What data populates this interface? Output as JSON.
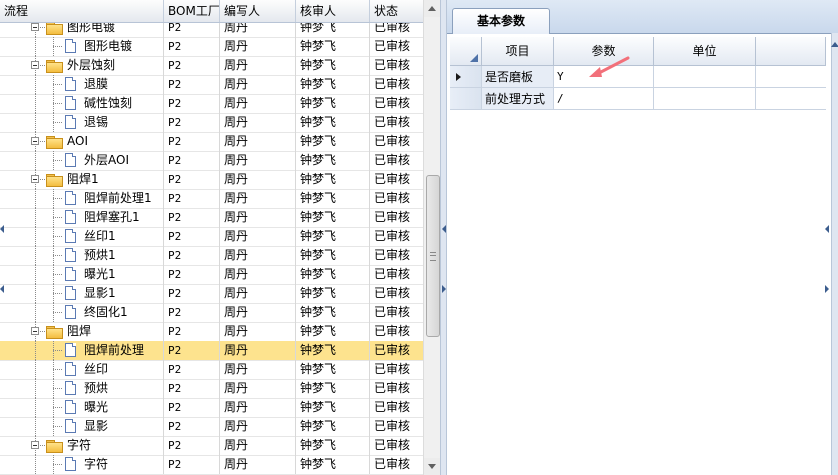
{
  "tree": {
    "columns": {
      "name": "流程",
      "bom": "BOM工厂",
      "writer": "编写人",
      "reviewer": "核审人",
      "status": "状态"
    },
    "rows": [
      {
        "name": "图形电镀",
        "type": "folder",
        "level": 0,
        "bom": "P2",
        "writer": "周丹",
        "reviewer": "钟梦飞",
        "status": "已审核"
      },
      {
        "name": "图形电镀",
        "type": "item",
        "level": 1,
        "bom": "P2",
        "writer": "周丹",
        "reviewer": "钟梦飞",
        "status": "已审核"
      },
      {
        "name": "外层蚀刻",
        "type": "folder",
        "level": 0,
        "bom": "P2",
        "writer": "周丹",
        "reviewer": "钟梦飞",
        "status": "已审核"
      },
      {
        "name": "退膜",
        "type": "item",
        "level": 1,
        "bom": "P2",
        "writer": "周丹",
        "reviewer": "钟梦飞",
        "status": "已审核"
      },
      {
        "name": "碱性蚀刻",
        "type": "item",
        "level": 1,
        "bom": "P2",
        "writer": "周丹",
        "reviewer": "钟梦飞",
        "status": "已审核"
      },
      {
        "name": "退锡",
        "type": "item",
        "level": 1,
        "bom": "P2",
        "writer": "周丹",
        "reviewer": "钟梦飞",
        "status": "已审核"
      },
      {
        "name": "AOI",
        "type": "folder",
        "level": 0,
        "bom": "P2",
        "writer": "周丹",
        "reviewer": "钟梦飞",
        "status": "已审核"
      },
      {
        "name": "外层AOI",
        "type": "item",
        "level": 1,
        "bom": "P2",
        "writer": "周丹",
        "reviewer": "钟梦飞",
        "status": "已审核"
      },
      {
        "name": "阻焊1",
        "type": "folder",
        "level": 0,
        "bom": "P2",
        "writer": "周丹",
        "reviewer": "钟梦飞",
        "status": "已审核"
      },
      {
        "name": "阻焊前处理1",
        "type": "item",
        "level": 1,
        "bom": "P2",
        "writer": "周丹",
        "reviewer": "钟梦飞",
        "status": "已审核"
      },
      {
        "name": "阻焊塞孔1",
        "type": "item",
        "level": 1,
        "bom": "P2",
        "writer": "周丹",
        "reviewer": "钟梦飞",
        "status": "已审核"
      },
      {
        "name": "丝印1",
        "type": "item",
        "level": 1,
        "bom": "P2",
        "writer": "周丹",
        "reviewer": "钟梦飞",
        "status": "已审核"
      },
      {
        "name": "预烘1",
        "type": "item",
        "level": 1,
        "bom": "P2",
        "writer": "周丹",
        "reviewer": "钟梦飞",
        "status": "已审核"
      },
      {
        "name": "曝光1",
        "type": "item",
        "level": 1,
        "bom": "P2",
        "writer": "周丹",
        "reviewer": "钟梦飞",
        "status": "已审核"
      },
      {
        "name": "显影1",
        "type": "item",
        "level": 1,
        "bom": "P2",
        "writer": "周丹",
        "reviewer": "钟梦飞",
        "status": "已审核"
      },
      {
        "name": "终固化1",
        "type": "item",
        "level": 1,
        "bom": "P2",
        "writer": "周丹",
        "reviewer": "钟梦飞",
        "status": "已审核"
      },
      {
        "name": "阻焊",
        "type": "folder",
        "level": 0,
        "bom": "P2",
        "writer": "周丹",
        "reviewer": "钟梦飞",
        "status": "已审核"
      },
      {
        "name": "阻焊前处理",
        "type": "item",
        "level": 1,
        "bom": "P2",
        "writer": "周丹",
        "reviewer": "钟梦飞",
        "status": "已审核",
        "selected": true
      },
      {
        "name": "丝印",
        "type": "item",
        "level": 1,
        "bom": "P2",
        "writer": "周丹",
        "reviewer": "钟梦飞",
        "status": "已审核"
      },
      {
        "name": "预烘",
        "type": "item",
        "level": 1,
        "bom": "P2",
        "writer": "周丹",
        "reviewer": "钟梦飞",
        "status": "已审核"
      },
      {
        "name": "曝光",
        "type": "item",
        "level": 1,
        "bom": "P2",
        "writer": "周丹",
        "reviewer": "钟梦飞",
        "status": "已审核"
      },
      {
        "name": "显影",
        "type": "item",
        "level": 1,
        "bom": "P2",
        "writer": "周丹",
        "reviewer": "钟梦飞",
        "status": "已审核"
      },
      {
        "name": "字符",
        "type": "folder",
        "level": 0,
        "bom": "P2",
        "writer": "周丹",
        "reviewer": "钟梦飞",
        "status": "已审核"
      },
      {
        "name": "字符",
        "type": "item",
        "level": 1,
        "bom": "P2",
        "writer": "周丹",
        "reviewer": "钟梦飞",
        "status": "已审核"
      }
    ]
  },
  "panel": {
    "tab_label": "基本参数",
    "columns": {
      "item": "项目",
      "param": "参数",
      "unit": "单位"
    },
    "rows": [
      {
        "item": "是否磨板",
        "param": "Y",
        "unit": "",
        "current": true
      },
      {
        "item": "前处理方式",
        "param": "/",
        "unit": "",
        "current": false
      }
    ]
  },
  "colors": {
    "selected_row": "#fde38e",
    "annotation_arrow": "#f2707a",
    "header_blue": "#4f72a8"
  }
}
